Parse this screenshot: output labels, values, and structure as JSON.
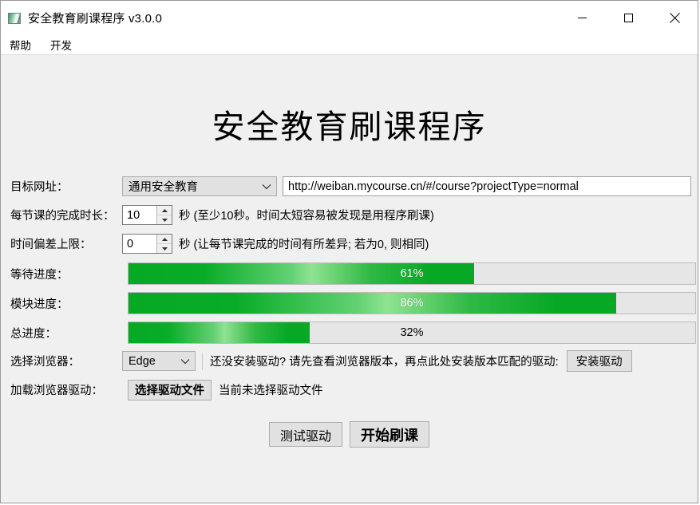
{
  "window": {
    "title": "安全教育刷课程序 v3.0.0",
    "icon": "app-image-icon",
    "controls": {
      "minimize": "minimize-icon",
      "maximize": "maximize-icon",
      "close": "close-icon"
    }
  },
  "menubar": {
    "items": [
      {
        "label": "帮助"
      },
      {
        "label": "开发"
      }
    ]
  },
  "main": {
    "heading": "安全教育刷课程序",
    "target_url_row": {
      "label": "目标网址：",
      "select_value": "通用安全教育",
      "url_value": "http://weiban.mycourse.cn/#/course?projectType=normal",
      "url_placeholder": "http://weiban.mycourse.cn/#/course?projectType=normal"
    },
    "duration_row": {
      "label": "每节课的完成时长：",
      "value": "10",
      "hint": "秒 (至少10秒。时间太短容易被发现是用程序刷课)"
    },
    "deviation_row": {
      "label": "时间偏差上限：",
      "value": "0",
      "hint": "秒 (让每节课完成的时间有所差异; 若为0, 则相同)"
    },
    "progress_rows": [
      {
        "label": "等待进度：",
        "text": "61%",
        "percent": 61
      },
      {
        "label": "模块进度：",
        "text": "86%",
        "percent": 86
      },
      {
        "label": "总进度：",
        "text": "32%",
        "percent": 32
      }
    ],
    "browser_row": {
      "label": "选择浏览器：",
      "select_value": "Edge",
      "install_text": "还没安装驱动? 请先查看浏览器版本，再点此处安装版本匹配的驱动:",
      "install_button": "安装驱动"
    },
    "driver_row": {
      "label": "加载浏览器驱动：",
      "choose_button": "选择驱动文件",
      "status": "当前未选择驱动文件"
    },
    "actions": {
      "test_button": "测试驱动",
      "start_button": "开始刷课"
    }
  },
  "colors": {
    "progress_green": "#06a824",
    "progress_track": "#e6e6e6",
    "window_bg": "#f0f0f0"
  }
}
